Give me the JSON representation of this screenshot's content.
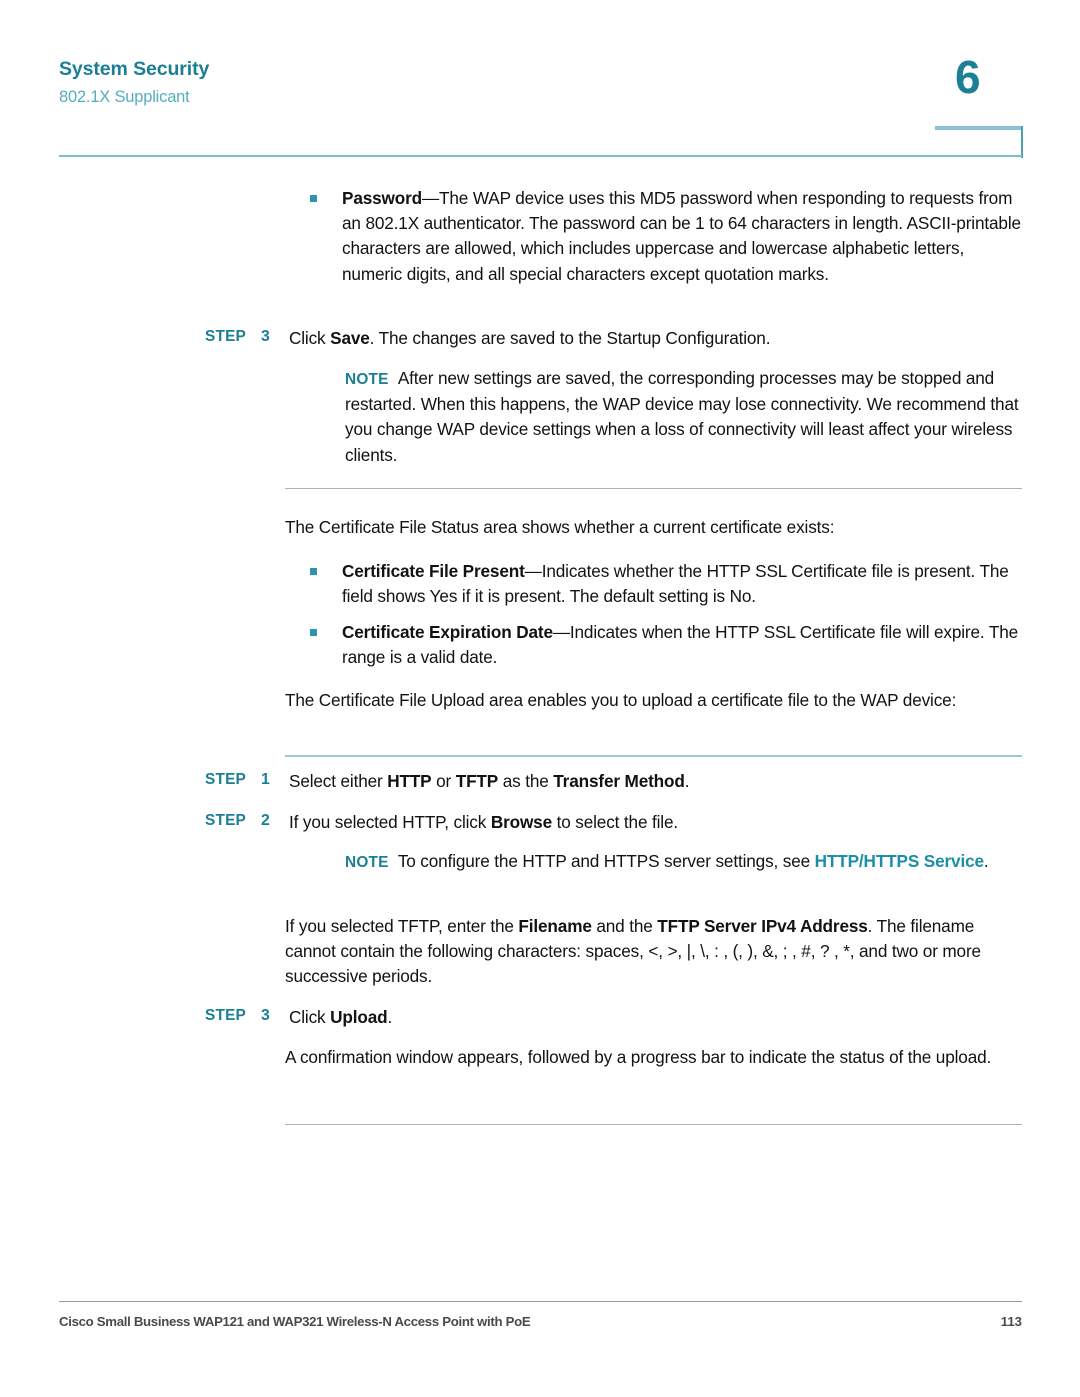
{
  "header": {
    "title": "System Security",
    "subtitle": "802.1X Supplicant",
    "chapter_number": "6"
  },
  "colors": {
    "heading_teal": "#1b7f96",
    "subtitle_teal": "#56adc0",
    "bullet_teal": "#2e93ab",
    "rule_teal": "#96cdd9",
    "rule_grey": "#b0b0b0",
    "xref_teal": "#1b8fa8",
    "body_text": "#121212",
    "footer_text": "#4a4a4a"
  },
  "body": {
    "bullet_password": {
      "term": "Password",
      "text": "—The WAP device uses this MD5 password when responding to requests from an 802.1X authenticator. The password can be 1 to 64 characters in length. ASCII-printable characters are allowed, which includes uppercase and lowercase alphabetic letters, numeric digits, and all special characters except quotation marks."
    },
    "step_save": {
      "label": "STEP",
      "number": "3",
      "text_before": "Click ",
      "bold": "Save",
      "text_after": ". The changes are saved to the Startup Configuration."
    },
    "note_save": {
      "label": "NOTE",
      "text": "After new settings are saved, the corresponding processes may be stopped and restarted. When this happens, the WAP device may lose connectivity. We recommend that you change WAP device settings when a loss of connectivity will least affect your wireless clients."
    },
    "para_cert_status": "The Certificate File Status area shows whether a current certificate exists:",
    "bullet_cert_present": {
      "term": "Certificate File Present",
      "text": "—Indicates whether the HTTP SSL Certificate file is present. The field shows Yes if it is present. The default setting is No."
    },
    "bullet_cert_expiration": {
      "term": "Certificate Expiration Date",
      "text": "—Indicates when the HTTP SSL Certificate file will expire. The range is a valid date."
    },
    "para_cert_upload": "The Certificate File Upload area enables you to upload a certificate file to the WAP device:",
    "step_transfer": {
      "label": "STEP",
      "number": "1",
      "seg1": "Select either ",
      "bold1": "HTTP",
      "seg2": " or ",
      "bold2": "TFTP",
      "seg3": " as the ",
      "bold3": "Transfer Method",
      "seg4": "."
    },
    "step_browse": {
      "label": "STEP",
      "number": "2",
      "seg1": "If you selected HTTP, click ",
      "bold1": "Browse",
      "seg2": " to select the file."
    },
    "note_http": {
      "label": "NOTE",
      "seg1": "To configure the HTTP and HTTPS server settings, see ",
      "xref": "HTTP/HTTPS Service",
      "seg2": "."
    },
    "para_tftp": {
      "seg1": "If you selected TFTP, enter the ",
      "bold1": "Filename",
      "seg2": " and the ",
      "bold2": "TFTP Server IPv4 Address",
      "seg3": ". The filename cannot contain the following characters: spaces, <, >, |, \\, : , (, ), &, ; , #, ? , *, and two or more successive periods."
    },
    "step_upload": {
      "label": "STEP",
      "number": "3",
      "seg1": "Click ",
      "bold1": "Upload",
      "seg2": "."
    },
    "para_confirm": "A confirmation window appears, followed by a progress bar to indicate the status of the upload."
  },
  "footer": {
    "left": "Cisco Small Business WAP121 and WAP321 Wireless-N Access Point with PoE",
    "page_number": "113"
  }
}
